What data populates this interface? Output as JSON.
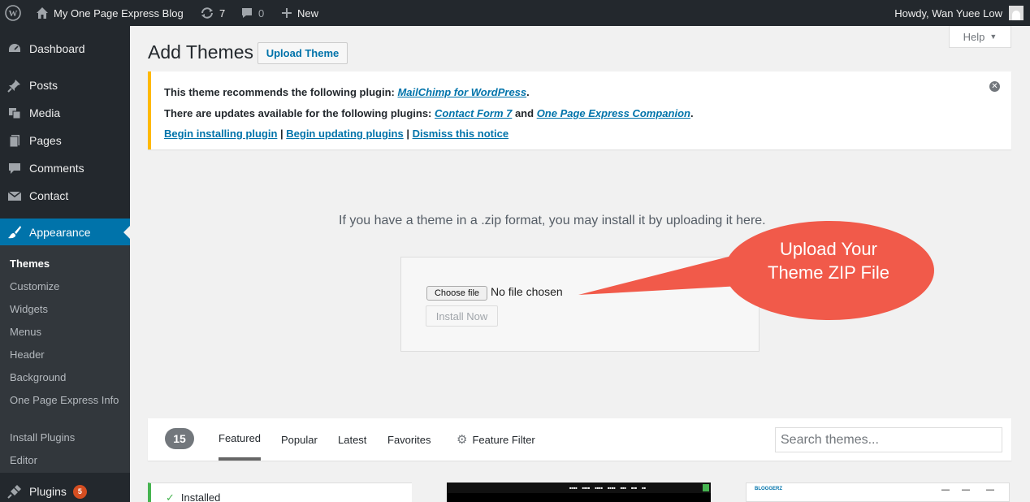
{
  "adminbar": {
    "site_name": "My One Page Express Blog",
    "updates_count": "7",
    "comments_count": "0",
    "new_label": "New",
    "greeting": "Howdy, Wan Yuee Low"
  },
  "sidebar": {
    "items": [
      {
        "label": "Dashboard",
        "icon": "dashboard-icon"
      },
      {
        "label": "Posts",
        "icon": "pin-icon"
      },
      {
        "label": "Media",
        "icon": "media-icon"
      },
      {
        "label": "Pages",
        "icon": "pages-icon"
      },
      {
        "label": "Comments",
        "icon": "comment-icon"
      },
      {
        "label": "Contact",
        "icon": "envelope-icon"
      },
      {
        "label": "Appearance",
        "icon": "paintbrush-icon"
      },
      {
        "label": "Plugins",
        "icon": "plugin-icon",
        "badge": "5"
      }
    ],
    "submenu": [
      "Themes",
      "Customize",
      "Widgets",
      "Menus",
      "Header",
      "Background",
      "One Page Express Info",
      "Install Plugins",
      "Editor"
    ]
  },
  "header": {
    "title": "Add Themes",
    "upload_button": "Upload Theme",
    "help": "Help"
  },
  "notice": {
    "line1_prefix": "This theme recommends the following plugin: ",
    "line1_link": "MailChimp for WordPress",
    "line1_suffix": ".",
    "line2_prefix": "There are updates available for the following plugins: ",
    "line2_link1": "Contact Form 7",
    "line2_mid": " and ",
    "line2_link2": "One Page Express Companion",
    "line2_suffix": ".",
    "action1": "Begin installing plugin",
    "action2": "Begin updating plugins",
    "action3": "Dismiss this notice",
    "sep": " | "
  },
  "upload": {
    "description": "If you have a theme in a .zip format, you may install it by uploading it here.",
    "choose_file": "Choose file",
    "no_file": "No file chosen",
    "install_now": "Install Now"
  },
  "callout": {
    "text": "Upload Your Theme ZIP File",
    "color": "#f15a4a"
  },
  "filter": {
    "count": "15",
    "tabs": [
      "Featured",
      "Popular",
      "Latest",
      "Favorites"
    ],
    "feature_filter": "Feature Filter",
    "search_placeholder": "Search themes..."
  },
  "themes": {
    "installed_label": "Installed",
    "card3_logo": "BLOGGERZ"
  },
  "colors": {
    "adminbar": "#23282d",
    "accent": "#0073aa",
    "notice_border": "#ffb900",
    "installed": "#46b450"
  }
}
